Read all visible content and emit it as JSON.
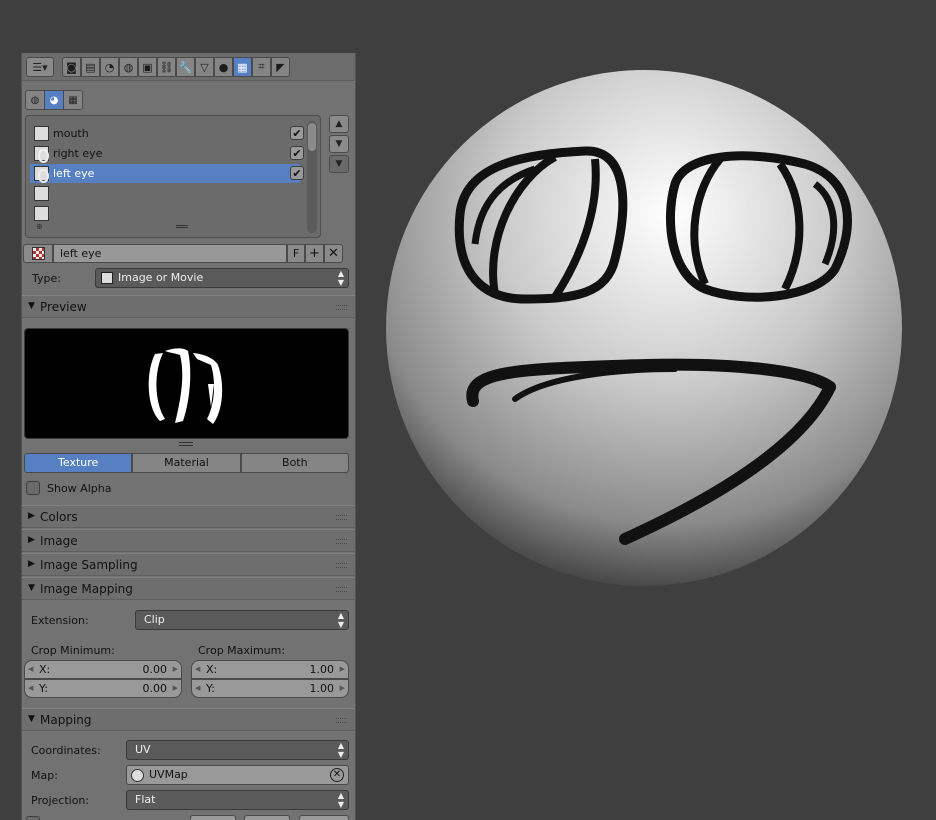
{
  "properties": {
    "tabs": [
      {
        "icon": "render-icon",
        "glyph": "◙"
      },
      {
        "icon": "render-layers-icon",
        "glyph": "▤"
      },
      {
        "icon": "scene-icon",
        "glyph": "◔"
      },
      {
        "icon": "world-icon",
        "glyph": "◍"
      },
      {
        "icon": "object-icon",
        "glyph": "▣"
      },
      {
        "icon": "constraints-icon",
        "glyph": "⛓"
      },
      {
        "icon": "modifiers-icon",
        "glyph": "🔧"
      },
      {
        "icon": "data-icon",
        "glyph": "▽"
      },
      {
        "icon": "material-icon",
        "glyph": "●"
      },
      {
        "icon": "texture-icon",
        "glyph": "▦"
      },
      {
        "icon": "particles-icon",
        "glyph": "⌗"
      },
      {
        "icon": "physics-icon",
        "glyph": "◤"
      }
    ],
    "active_tab": "texture-icon"
  },
  "texture_context": {
    "buttons": [
      {
        "icon": "world-texture-icon",
        "glyph": "◍"
      },
      {
        "icon": "material-texture-icon",
        "glyph": "◕"
      },
      {
        "icon": "other-texture-icon",
        "glyph": "▦"
      }
    ]
  },
  "texture_slots": [
    {
      "name": "mouth",
      "thumb": "checker-bw",
      "checked": true,
      "selected": false
    },
    {
      "name": "right eye",
      "thumb": "eye",
      "checked": true,
      "selected": false
    },
    {
      "name": "left eye",
      "thumb": "eye",
      "checked": true,
      "selected": true
    },
    {
      "name": "",
      "thumb": "checker",
      "checked": false,
      "selected": false
    },
    {
      "name": "",
      "thumb": "checker",
      "checked": false,
      "selected": false
    }
  ],
  "texture": {
    "name": "left eye",
    "fake_user": "F",
    "type_label": "Type:",
    "type_value": "Image or Movie"
  },
  "preview": {
    "title": "Preview",
    "modes": [
      "Texture",
      "Material",
      "Both"
    ],
    "active_mode": "Texture",
    "show_alpha_label": "Show Alpha",
    "show_alpha": false
  },
  "sections": {
    "colors": "Colors",
    "image": "Image",
    "image_sampling": "Image Sampling",
    "image_mapping": "Image Mapping",
    "mapping": "Mapping"
  },
  "image_mapping": {
    "extension_label": "Extension:",
    "extension_value": "Clip",
    "crop_min_label": "Crop Minimum:",
    "crop_max_label": "Crop Maximum:",
    "crop_min_x": "0.00",
    "crop_min_y": "0.00",
    "crop_max_x": "1.00",
    "crop_max_y": "1.00",
    "x_label": "X:",
    "y_label": "Y:"
  },
  "mapping": {
    "coordinates_label": "Coordinates:",
    "coordinates_value": "UV",
    "map_label": "Map:",
    "map_value": "UVMap",
    "projection_label": "Projection:",
    "projection_value": "Flat"
  }
}
